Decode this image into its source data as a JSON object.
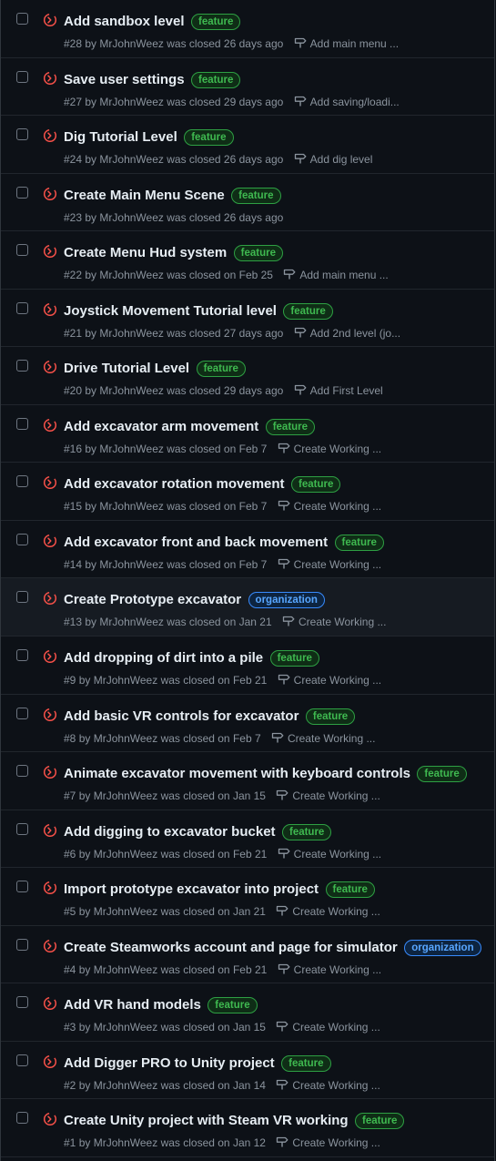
{
  "colors": {
    "closed_icon": "#f85149",
    "feature_label": "#3fb950",
    "organization_label": "#58a6ff"
  },
  "icons": {
    "state": "issue-closed-not-planned-icon",
    "milestone": "milestone-icon"
  },
  "issues": [
    {
      "title": "Add sandbox level",
      "label": "feature",
      "number": "#28",
      "by": "by",
      "author": "MrJohnWeez",
      "closed": "was closed 26 days ago",
      "milestone": "Add main menu ..."
    },
    {
      "title": "Save user settings",
      "label": "feature",
      "number": "#27",
      "by": "by",
      "author": "MrJohnWeez",
      "closed": "was closed 29 days ago",
      "milestone": "Add saving/loadi..."
    },
    {
      "title": "Dig Tutorial Level",
      "label": "feature",
      "number": "#24",
      "by": "by",
      "author": "MrJohnWeez",
      "closed": "was closed 26 days ago",
      "milestone": "Add dig level"
    },
    {
      "title": "Create Main Menu Scene",
      "label": "feature",
      "number": "#23",
      "by": "by",
      "author": "MrJohnWeez",
      "closed": "was closed 26 days ago",
      "milestone": ""
    },
    {
      "title": "Create Menu Hud system",
      "label": "feature",
      "number": "#22",
      "by": "by",
      "author": "MrJohnWeez",
      "closed": "was closed on Feb 25",
      "milestone": "Add main menu ..."
    },
    {
      "title": "Joystick Movement Tutorial level",
      "label": "feature",
      "number": "#21",
      "by": "by",
      "author": "MrJohnWeez",
      "closed": "was closed 27 days ago",
      "milestone": "Add 2nd level (jo..."
    },
    {
      "title": "Drive Tutorial Level",
      "label": "feature",
      "number": "#20",
      "by": "by",
      "author": "MrJohnWeez",
      "closed": "was closed 29 days ago",
      "milestone": "Add First Level"
    },
    {
      "title": "Add excavator arm movement",
      "label": "feature",
      "number": "#16",
      "by": "by",
      "author": "MrJohnWeez",
      "closed": "was closed on Feb 7",
      "milestone": "Create Working ..."
    },
    {
      "title": "Add excavator rotation movement",
      "label": "feature",
      "number": "#15",
      "by": "by",
      "author": "MrJohnWeez",
      "closed": "was closed on Feb 7",
      "milestone": "Create Working ..."
    },
    {
      "title": "Add excavator front and back movement",
      "label": "feature",
      "number": "#14",
      "by": "by",
      "author": "MrJohnWeez",
      "closed": "was closed on Feb 7",
      "milestone": "Create Working ..."
    },
    {
      "title": "Create Prototype excavator",
      "label": "organization",
      "number": "#13",
      "by": "by",
      "author": "MrJohnWeez",
      "closed": "was closed on Jan 21",
      "milestone": "Create Working ...",
      "highlight": true
    },
    {
      "title": "Add dropping of dirt into a pile",
      "label": "feature",
      "number": "#9",
      "by": "by",
      "author": "MrJohnWeez",
      "closed": "was closed on Feb 21",
      "milestone": "Create Working ..."
    },
    {
      "title": "Add basic VR controls for excavator",
      "label": "feature",
      "number": "#8",
      "by": "by",
      "author": "MrJohnWeez",
      "closed": "was closed on Feb 7",
      "milestone": "Create Working ..."
    },
    {
      "title": "Animate excavator movement with keyboard controls",
      "label": "feature",
      "number": "#7",
      "by": "by",
      "author": "MrJohnWeez",
      "closed": "was closed on Jan 15",
      "milestone": "Create Working ..."
    },
    {
      "title": "Add digging to excavator bucket",
      "label": "feature",
      "number": "#6",
      "by": "by",
      "author": "MrJohnWeez",
      "closed": "was closed on Feb 21",
      "milestone": "Create Working ..."
    },
    {
      "title": "Import prototype excavator into project",
      "label": "feature",
      "number": "#5",
      "by": "by",
      "author": "MrJohnWeez",
      "closed": "was closed on Jan 21",
      "milestone": "Create Working ..."
    },
    {
      "title": "Create Steamworks account and page for simulator",
      "label": "organization",
      "number": "#4",
      "by": "by",
      "author": "MrJohnWeez",
      "closed": "was closed on Feb 21",
      "milestone": "Create Working ..."
    },
    {
      "title": "Add VR hand models",
      "label": "feature",
      "number": "#3",
      "by": "by",
      "author": "MrJohnWeez",
      "closed": "was closed on Jan 15",
      "milestone": "Create Working ..."
    },
    {
      "title": "Add Digger PRO to Unity project",
      "label": "feature",
      "number": "#2",
      "by": "by",
      "author": "MrJohnWeez",
      "closed": "was closed on Jan 14",
      "milestone": "Create Working ..."
    },
    {
      "title": "Create Unity project with Steam VR working",
      "label": "feature",
      "number": "#1",
      "by": "by",
      "author": "MrJohnWeez",
      "closed": "was closed on Jan 12",
      "milestone": "Create Working ..."
    }
  ]
}
